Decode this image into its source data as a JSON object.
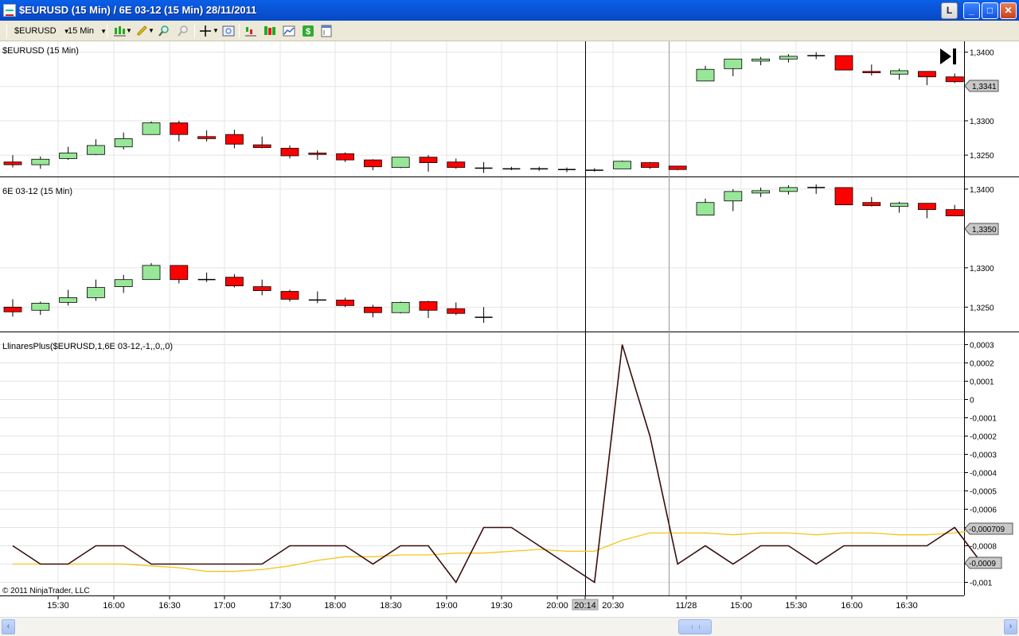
{
  "window": {
    "title": "$EURUSD (15 Min) / 6E 03-12 (15 Min)  28/11/2011",
    "buttons": {
      "link": "L",
      "minimize": "_",
      "maximize": "□",
      "close": "✕"
    }
  },
  "toolbar": {
    "instrument": "$EURUSD",
    "interval": "15 Min"
  },
  "panels": {
    "top": {
      "label": "$EURUSD (15 Min)",
      "price_marker": "1,3341",
      "ticks": [
        "1,3400",
        "1,3350",
        "1,3300",
        "1,3250"
      ]
    },
    "middle": {
      "label": "6E 03-12 (15 Min)",
      "price_marker": "1,3350",
      "ticks": [
        "1,3400",
        "1,3300",
        "1,3250"
      ]
    },
    "bottom": {
      "label": "LlinaresPlus($EURUSD,1,6E 03-12,-1,,0,,0)",
      "marker_a": "-0,000709",
      "marker_b": "-0,0009",
      "ticks": [
        "0,0003",
        "0,0002",
        "0,0001",
        "0",
        "-0,0001",
        "-0,0002",
        "-0,0003",
        "-0,0004",
        "-0,0005",
        "-0,0006",
        "-0,0007",
        "-0,0008",
        "-0,0009",
        "-0,001"
      ],
      "copyright": "© 2011 NinjaTrader, LLC"
    }
  },
  "time_axis": {
    "labels": [
      "15:30",
      "16:00",
      "16:30",
      "17:00",
      "17:30",
      "18:00",
      "18:30",
      "19:00",
      "19:30",
      "20:00",
      "20:14",
      "20:30",
      "11/28",
      "15:00",
      "15:30",
      "16:00",
      "16:30"
    ]
  },
  "colors": {
    "up": "#98e698",
    "down": "#ff0000",
    "line_main": "#3a0d0d",
    "line_avg": "#f5c518",
    "grid": "#e4e4e4"
  },
  "chart_data": {
    "type": "candlestick",
    "series": [
      {
        "name": "$EURUSD (15 Min)",
        "ohlc": [
          [
            1.324,
            1.325,
            1.3232,
            1.3236
          ],
          [
            1.3236,
            1.3248,
            1.323,
            1.3244
          ],
          [
            1.3245,
            1.3262,
            1.3243,
            1.3253
          ],
          [
            1.3251,
            1.3273,
            1.325,
            1.3264
          ],
          [
            1.3262,
            1.3283,
            1.3258,
            1.3274
          ],
          [
            1.328,
            1.3299,
            1.328,
            1.3297
          ],
          [
            1.3297,
            1.33,
            1.327,
            1.328
          ],
          [
            1.3277,
            1.3286,
            1.327,
            1.3274
          ],
          [
            1.328,
            1.3287,
            1.326,
            1.3266
          ],
          [
            1.3265,
            1.3277,
            1.326,
            1.3261
          ],
          [
            1.326,
            1.3264,
            1.3245,
            1.3249
          ],
          [
            1.3253,
            1.3257,
            1.3243,
            1.3251
          ],
          [
            1.3252,
            1.3254,
            1.324,
            1.3243
          ],
          [
            1.3243,
            1.3244,
            1.3228,
            1.3233
          ],
          [
            1.3232,
            1.3247,
            1.3231,
            1.3247
          ],
          [
            1.3247,
            1.325,
            1.3226,
            1.3239
          ],
          [
            1.324,
            1.3245,
            1.323,
            1.3232
          ],
          [
            1.3231,
            1.324,
            1.3224,
            1.3231
          ],
          [
            1.323,
            1.3233,
            1.3228,
            1.323
          ],
          [
            1.323,
            1.3233,
            1.3227,
            1.323
          ],
          [
            1.3229,
            1.3232,
            1.3225,
            1.3228
          ],
          [
            1.3228,
            1.3231,
            1.3226,
            1.3227
          ],
          [
            1.323,
            1.3242,
            1.323,
            1.3241
          ],
          [
            1.3239,
            1.324,
            1.323,
            1.3232
          ],
          [
            1.3234,
            1.3234,
            1.3228,
            1.3229
          ],
          [
            1.3358,
            1.338,
            1.3358,
            1.3375
          ],
          [
            1.3376,
            1.339,
            1.3365,
            1.339
          ],
          [
            1.3387,
            1.3393,
            1.3381,
            1.339
          ],
          [
            1.339,
            1.3397,
            1.3385,
            1.3394
          ],
          [
            1.3395,
            1.34,
            1.339,
            1.3395
          ],
          [
            1.3395,
            1.3395,
            1.3374,
            1.3374
          ],
          [
            1.3372,
            1.3382,
            1.3366,
            1.337
          ],
          [
            1.3368,
            1.3376,
            1.336,
            1.3373
          ],
          [
            1.3372,
            1.3372,
            1.3352,
            1.3364
          ],
          [
            1.3364,
            1.3369,
            1.3355,
            1.3357
          ]
        ]
      },
      {
        "name": "6E 03-12 (15 Min)",
        "ohlc": [
          [
            1.325,
            1.326,
            1.3238,
            1.3244
          ],
          [
            1.3246,
            1.3257,
            1.324,
            1.3255
          ],
          [
            1.3256,
            1.3272,
            1.3252,
            1.3262
          ],
          [
            1.3262,
            1.3285,
            1.3258,
            1.3275
          ],
          [
            1.3276,
            1.3291,
            1.3268,
            1.3285
          ],
          [
            1.3285,
            1.3306,
            1.3285,
            1.3303
          ],
          [
            1.3303,
            1.3303,
            1.328,
            1.3285
          ],
          [
            1.3285,
            1.3294,
            1.3282,
            1.3285
          ],
          [
            1.3288,
            1.3292,
            1.3275,
            1.3277
          ],
          [
            1.3276,
            1.3285,
            1.3265,
            1.3271
          ],
          [
            1.327,
            1.3272,
            1.3257,
            1.326
          ],
          [
            1.3259,
            1.327,
            1.3255,
            1.3259
          ],
          [
            1.3259,
            1.3262,
            1.325,
            1.3252
          ],
          [
            1.325,
            1.3253,
            1.3237,
            1.3243
          ],
          [
            1.3243,
            1.3257,
            1.3242,
            1.3256
          ],
          [
            1.3257,
            1.3258,
            1.3236,
            1.3246
          ],
          [
            1.3248,
            1.3256,
            1.324,
            1.3242
          ],
          [
            1.3237,
            1.325,
            1.323,
            1.3237
          ],
          null,
          null,
          null,
          null,
          null,
          null,
          null,
          [
            1.3367,
            1.3388,
            1.3367,
            1.3383
          ],
          [
            1.3385,
            1.34,
            1.3372,
            1.3397
          ],
          [
            1.3395,
            1.3402,
            1.339,
            1.3398
          ],
          [
            1.3397,
            1.3405,
            1.3393,
            1.3402
          ],
          [
            1.3401,
            1.3406,
            1.3394,
            1.3402
          ],
          [
            1.3402,
            1.3402,
            1.338,
            1.338
          ],
          [
            1.3383,
            1.339,
            1.3378,
            1.3379
          ],
          [
            1.3378,
            1.3384,
            1.337,
            1.3382
          ],
          [
            1.3382,
            1.3382,
            1.3363,
            1.3374
          ],
          [
            1.3374,
            1.338,
            1.3366,
            1.3366
          ]
        ]
      }
    ],
    "indicator": {
      "name": "LlinaresPlus($EURUSD,1,6E 03-12,-1,,0,,0)",
      "values": [
        -0.0008,
        -0.0009,
        -0.0009,
        -0.0008,
        -0.0008,
        -0.0009,
        -0.0009,
        -0.0009,
        -0.0009,
        -0.0009,
        -0.0008,
        -0.0008,
        -0.0008,
        -0.0009,
        -0.0008,
        -0.0008,
        -0.001,
        -0.0007,
        -0.0007,
        -0.0008,
        -0.0009,
        -0.001,
        0.0003,
        -0.0002,
        -0.0009,
        -0.0008,
        -0.0009,
        -0.0008,
        -0.0008,
        -0.0009,
        -0.0008,
        -0.0008,
        -0.0008,
        -0.0008,
        -0.0007,
        -0.0009
      ],
      "average": [
        -0.0009,
        -0.0009,
        -0.0009,
        -0.0009,
        -0.0009,
        -0.00091,
        -0.00092,
        -0.00094,
        -0.00094,
        -0.00093,
        -0.00091,
        -0.00088,
        -0.00086,
        -0.00086,
        -0.00085,
        -0.00085,
        -0.00084,
        -0.00084,
        -0.00083,
        -0.00082,
        -0.00083,
        -0.00083,
        -0.00077,
        -0.00073,
        -0.00073,
        -0.00073,
        -0.00074,
        -0.00073,
        -0.00073,
        -0.00074,
        -0.00073,
        -0.00073,
        -0.00074,
        -0.00074,
        -0.00073,
        -0.00071
      ],
      "ylim": [
        -0.00105,
        0.00035
      ]
    },
    "ylim_top": [
      1.322,
      1.341
    ],
    "ylim_middle": [
      1.322,
      1.341
    ]
  }
}
